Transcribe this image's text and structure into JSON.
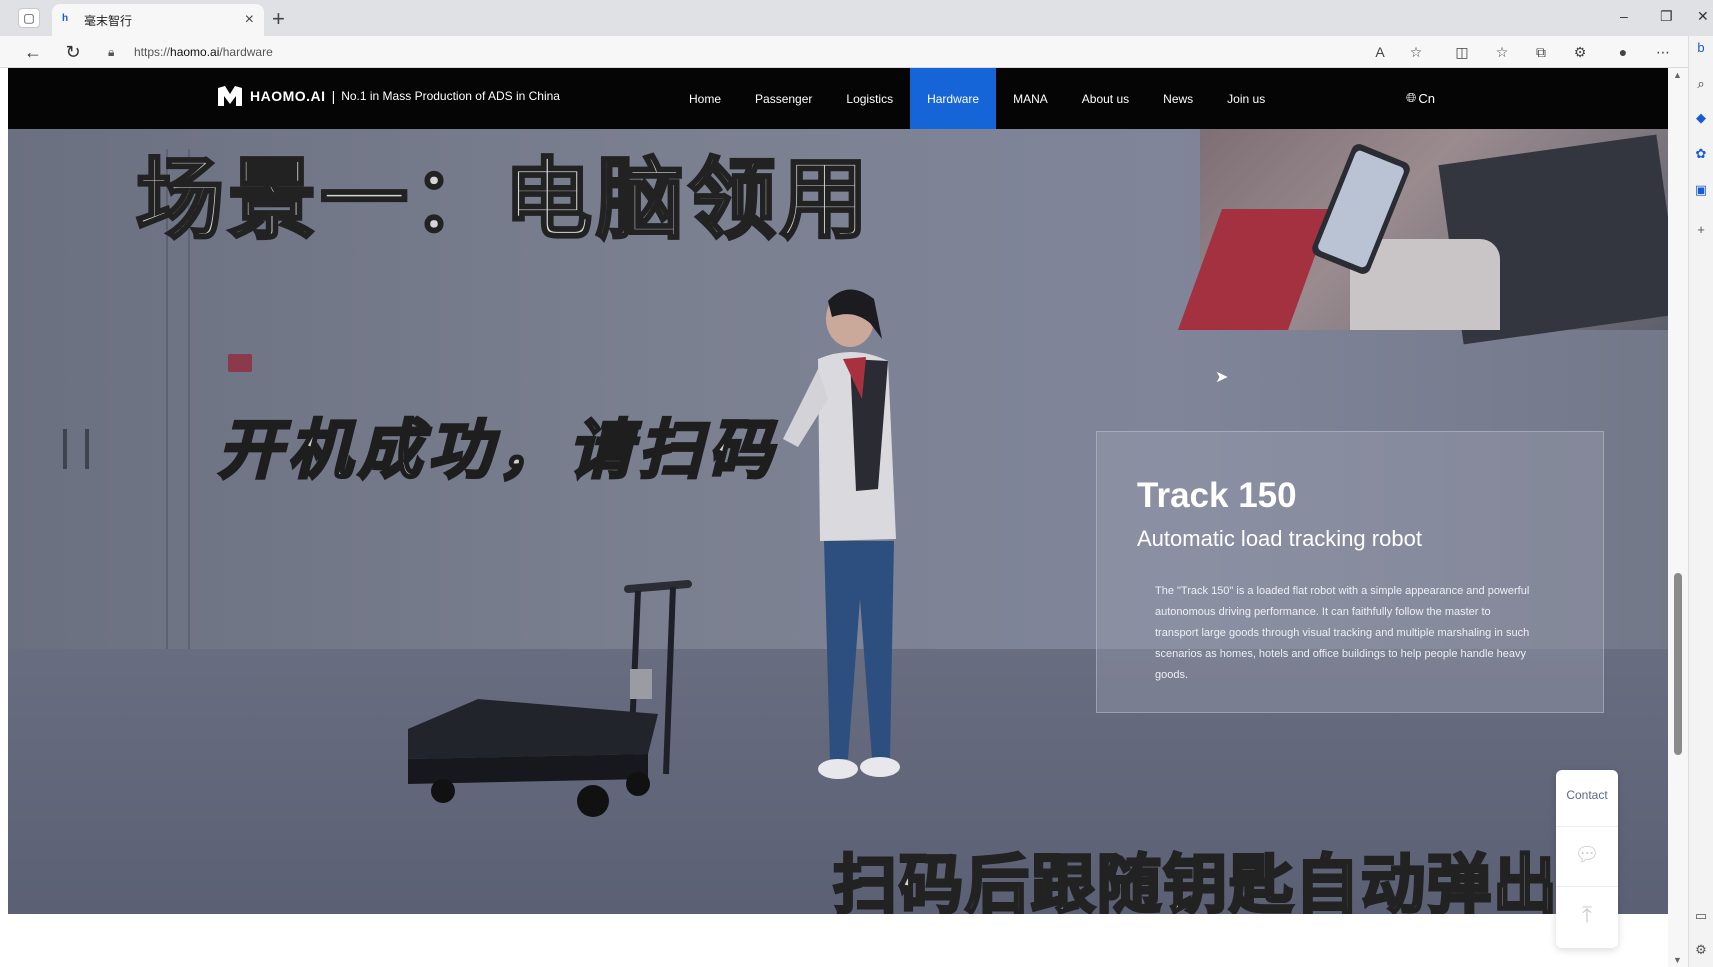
{
  "browser": {
    "tab_title": "毫末智行",
    "favicon": "h",
    "url_prefix": "https://",
    "url_host": "haomo.ai",
    "url_path": "/hardware",
    "icons": [
      "sidebar-toggle-icon",
      "back-icon",
      "refresh-icon",
      "lock-icon",
      "read-aloud-icon",
      "favorite-star-icon",
      "split-screen-icon",
      "favorites-icon",
      "collections-icon",
      "extensions-icon",
      "profile-icon",
      "more-icon",
      "bing-icon"
    ]
  },
  "site": {
    "brand": "HAOMO.AI",
    "separator": "|",
    "tagline": "No.1 in Mass Production of ADS in China",
    "nav": [
      {
        "label": "Home"
      },
      {
        "label": "Passenger"
      },
      {
        "label": "Logistics"
      },
      {
        "label": "Hardware",
        "active": true
      },
      {
        "label": "MANA"
      },
      {
        "label": "About us"
      },
      {
        "label": "News"
      },
      {
        "label": "Join us"
      }
    ],
    "language": "Cn"
  },
  "hero": {
    "caption_top": "场景一：电脑领用",
    "caption_mid": "开机成功，请扫码",
    "caption_bottom": "扫码后跟随钥匙自动弹出",
    "product_title": "Track 150",
    "product_subtitle": "Automatic load tracking robot",
    "product_description": "The \"Track 150\" is a loaded flat robot with a simple appearance and powerful autonomous driving performance. It can faithfully follow the master to transport large goods through visual tracking and multiple marshaling in such scenarios as homes, hotels and office buildings to help people handle heavy goods."
  },
  "widget": {
    "contact_label": "Contact",
    "wechat_icon": "wechat-icon",
    "back_to_top_icon": "back-to-top-icon"
  },
  "colors": {
    "header_bg": "#050505",
    "nav_active": "#1565d8",
    "edge_accent": "#1a5ad6"
  }
}
